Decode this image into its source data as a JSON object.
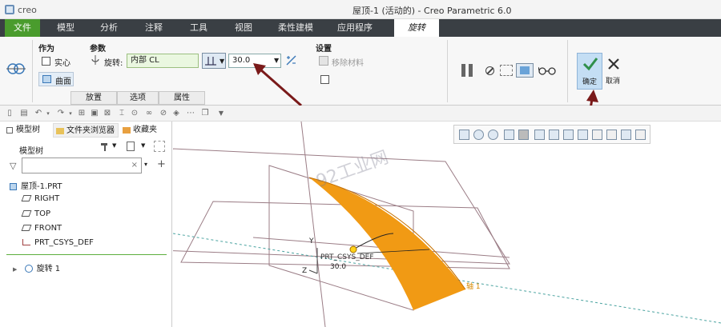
{
  "titlebar": {
    "logo_text": "creo",
    "window_title": "屋顶-1 (活动的) - Creo Parametric 6.0"
  },
  "menu": {
    "tabs": [
      "文件",
      "模型",
      "分析",
      "注释",
      "工具",
      "视图",
      "柔性建模",
      "应用程序",
      "旋转"
    ]
  },
  "ribbon": {
    "group_as": "作为",
    "solid": "实心",
    "surface": "曲面",
    "group_params": "参数",
    "rotate_label": "旋转:",
    "axis_value": "内部 CL",
    "angle_value": "30.0",
    "group_settings": "设置",
    "remove_material": "移除材料",
    "confirm": "确定",
    "cancel": "取消",
    "subtabs": [
      "放置",
      "选项",
      "属性"
    ]
  },
  "left_panel": {
    "tab_model_tree": "模型树",
    "tab_folder_browser": "文件夹浏览器",
    "tab_favorites": "收藏夹",
    "tree_header": "模型树",
    "search_placeholder": "",
    "items": [
      "屋顶-1.PRT",
      "RIGHT",
      "TOP",
      "FRONT",
      "PRT_CSYS_DEF",
      "旋转 1"
    ]
  },
  "viewport": {
    "label_y": "Y",
    "label_z": "Z",
    "csys_label": "PRT_CSYS_DEF",
    "angle_label": "30.0",
    "axis_label": "轴 1",
    "watermark": "92工业网"
  },
  "colors": {
    "file_tab": "#4a9c2d",
    "surface": "#f19a14",
    "arrow": "#7a1a1a"
  }
}
